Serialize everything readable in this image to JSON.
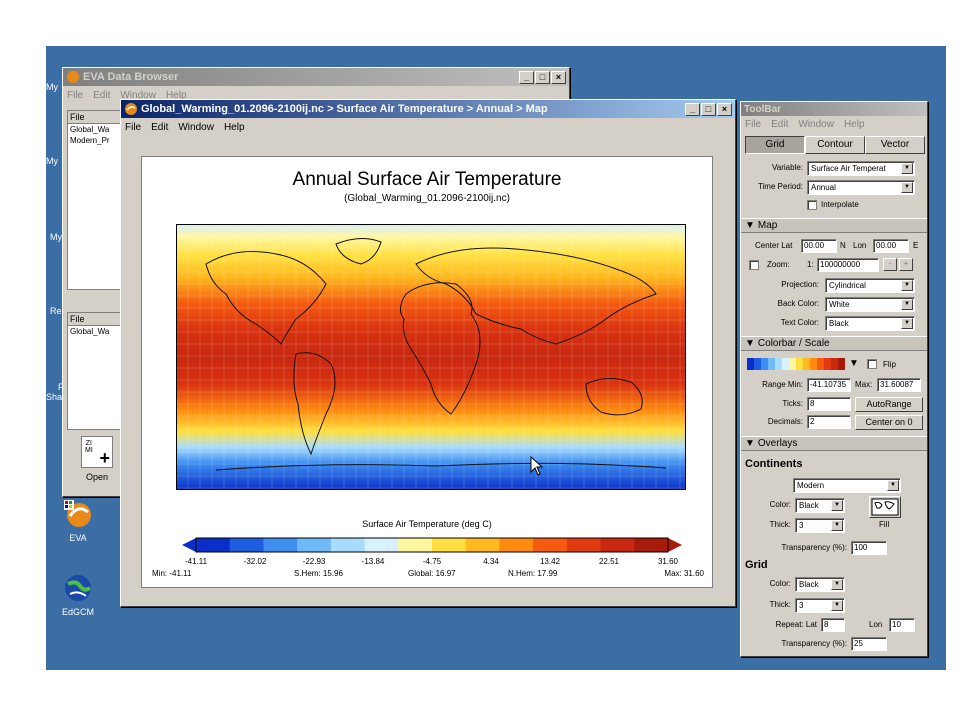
{
  "desktop": {
    "icons": [
      {
        "label": "Open",
        "icon": "open-file-icon"
      },
      {
        "label": "EVA",
        "icon": "eva-app-icon"
      },
      {
        "label": "EdGCM",
        "icon": "edgcm-app-icon"
      }
    ],
    "fragments": [
      "My",
      "My",
      "My",
      "Re",
      "Shar",
      "F"
    ]
  },
  "data_browser": {
    "title": "EVA Data Browser",
    "menu": [
      "File",
      "Edit",
      "Window",
      "Help"
    ],
    "panel1": {
      "header": "File",
      "items": [
        "Global_Wa",
        "Modern_Pr"
      ]
    },
    "panel2": {
      "header": "File",
      "items": [
        "Global_Wa"
      ]
    }
  },
  "map_window": {
    "title": "Global_Warming_01.2096-2100ij.nc > Surface Air Temperature > Annual > Map",
    "menu": [
      "File",
      "Edit",
      "Window",
      "Help"
    ],
    "plot_title": "Annual Surface Air Temperature",
    "plot_subtitle": "(Global_Warming_01.2096-2100ij.nc)",
    "colorbar_label": "Surface Air Temperature (deg C)",
    "colorbar_ticks": [
      "-41.11",
      "-32.02",
      "-22.93",
      "-13.84",
      "-4.75",
      "4.34",
      "13.42",
      "22.51",
      "31.60"
    ],
    "colorbar_colors": [
      "#0a2fc8",
      "#1f5de0",
      "#3d8ef0",
      "#6fb9f8",
      "#a8dcff",
      "#d8f1ff",
      "#fff7a0",
      "#ffe040",
      "#ffb820",
      "#ff8a10",
      "#f55a10",
      "#e03a10",
      "#c82810",
      "#a81a0a"
    ],
    "stats": {
      "min": "Min: -41.11",
      "shem": "S.Hem: 15.96",
      "global": "Global: 16.97",
      "nhem": "N.Hem: 17.99",
      "max": "Max: 31.60"
    }
  },
  "toolbar": {
    "title": "ToolBar",
    "menu": [
      "File",
      "Edit",
      "Window",
      "Help"
    ],
    "tabs": [
      "Grid",
      "Contour",
      "Vector"
    ],
    "variable_label": "Variable:",
    "variable_value": "Surface Air Temperat",
    "time_period_label": "Time Period:",
    "time_period_value": "Annual",
    "interpolate_label": "Interpolate",
    "map_section": "Map",
    "center_lat_label": "Center Lat",
    "center_lat_value": "00.00",
    "lat_unit": "N",
    "lon_label": "Lon",
    "center_lon_value": "00.00",
    "lon_unit": "E",
    "zoom_label": "Zoom:",
    "zoom_prefix": "1:",
    "zoom_value": "100000000",
    "projection_label": "Projection:",
    "projection_value": "Cylindrical",
    "back_color_label": "Back Color:",
    "back_color_value": "White",
    "text_color_label": "Text Color:",
    "text_color_value": "Black",
    "colorbar_section": "Colorbar / Scale",
    "flip_label": "Flip",
    "range_min_label": "Range Min:",
    "range_min_value": "-41.10735",
    "max_label": "Max:",
    "max_value": "31.60087",
    "ticks_label": "Ticks:",
    "ticks_value": "8",
    "autorange_label": "AutoRange",
    "decimals_label": "Decimals:",
    "decimals_value": "2",
    "center_on_0_label": "Center on 0",
    "overlays_section": "Overlays",
    "continents_heading": "Continents",
    "continents_value": "Modern",
    "cont_color_label": "Color:",
    "cont_color_value": "Black",
    "cont_thick_label": "Thick:",
    "cont_thick_value": "3",
    "fill_label": "Fill",
    "cont_transparency_label": "Transparency (%):",
    "cont_transparency_value": "100",
    "grid_heading": "Grid",
    "grid_color_label": "Color:",
    "grid_color_value": "Black",
    "grid_thick_label": "Thick:",
    "grid_thick_value": "3",
    "repeat_lat_label": "Repeat: Lat",
    "repeat_lat_value": "8",
    "grid_lon_label": "Lon",
    "repeat_lon_value": "10",
    "grid_transparency_label": "Transparency (%):",
    "grid_transparency_value": "25"
  }
}
